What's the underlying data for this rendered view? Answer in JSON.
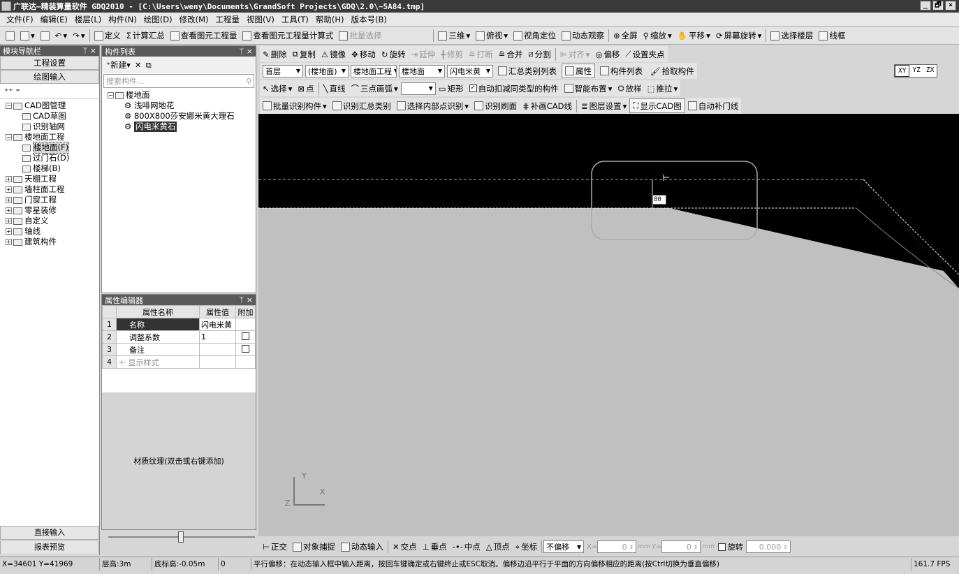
{
  "title": "广联达—精装算量软件 GDQ2010 - [C:\\Users\\weny\\Documents\\GrandSoft Projects\\GDQ\\2.0\\~5A84.tmp]",
  "window_controls": [
    "_",
    "🗗",
    "×"
  ],
  "menu": [
    "文件(F)",
    "编辑(E)",
    "楼层(L)",
    "构件(N)",
    "绘图(D)",
    "修改(M)",
    "工程量",
    "视图(V)",
    "工具(T)",
    "帮助(H)",
    "版本号(B)"
  ],
  "main_toolbar": {
    "define": "定义",
    "sum": "计算汇总",
    "view_qty": "查看图元工程量",
    "view_formula": "查看图元工程量计算式",
    "batch_select": "批量选择",
    "threeD": "三维",
    "top_view": "俯视",
    "view_locate": "视角定位",
    "dynamic": "动态观察",
    "fullscreen": "全屏",
    "zoom": "缩放",
    "pan": "平移",
    "rotate_screen": "屏幕旋转",
    "select_floor": "选择楼层",
    "wireframe": "线框"
  },
  "nav": {
    "title": "模块导航栏",
    "btn_project": "工程设置",
    "btn_draw": "绘图输入",
    "tree": [
      {
        "label": "CAD图管理",
        "level": 0,
        "expanded": true
      },
      {
        "label": "CAD草图",
        "level": 1
      },
      {
        "label": "识别轴网",
        "level": 1
      },
      {
        "label": "楼地面工程",
        "level": 0,
        "expanded": true
      },
      {
        "label": "楼地面(F)",
        "level": 1,
        "selected": true
      },
      {
        "label": "过门石(D)",
        "level": 1
      },
      {
        "label": "楼梯(B)",
        "level": 1
      },
      {
        "label": "天棚工程",
        "level": 0
      },
      {
        "label": "墙柱面工程",
        "level": 0
      },
      {
        "label": "门窗工程",
        "level": 0
      },
      {
        "label": "零星装修",
        "level": 0
      },
      {
        "label": "自定义",
        "level": 0
      },
      {
        "label": "轴线",
        "level": 0
      },
      {
        "label": "建筑构件",
        "level": 0
      }
    ],
    "btn_direct": "直接输入",
    "btn_report": "报表预览"
  },
  "comp": {
    "title": "构件列表",
    "new": "新建",
    "search_placeholder": "搜索构件...",
    "root": "楼地面",
    "items": [
      "浅啡网地花",
      "800X800莎安娜米黄大理石",
      "闪电米黄石"
    ]
  },
  "props": {
    "title": "属性编辑器",
    "headers": [
      "属性名称",
      "属性值",
      "附加"
    ],
    "rows": [
      {
        "n": "1",
        "name": "名称",
        "value": "闪电米黄"
      },
      {
        "n": "2",
        "name": "调整系数",
        "value": "1"
      },
      {
        "n": "3",
        "name": "备注",
        "value": ""
      },
      {
        "n": "4",
        "name": "显示样式",
        "value": ""
      }
    ],
    "texture": "材质纹理(双击或右键添加)"
  },
  "edit_tb": {
    "delete": "删除",
    "copy": "复制",
    "mirror": "镜像",
    "move": "移动",
    "rotate": "旋转",
    "extend": "延伸",
    "trim": "修剪",
    "break": "打断",
    "merge": "合并",
    "split": "分割",
    "align": "对齐",
    "offset": "偏移",
    "set_grip": "设置夹点"
  },
  "filter_tb": {
    "floor": "首层",
    "cat": "(楼地面)",
    "type": "楼地面工程",
    "sub": "楼地面",
    "comp": "闪电米黄",
    "sum_list": "汇总类别列表",
    "attr": "属性",
    "comp_list": "构件列表",
    "pick": "拾取构件"
  },
  "draw_tb": {
    "select": "选择",
    "point": "点",
    "line": "直线",
    "arc": "三点画弧",
    "rect": "矩形",
    "auto_deduct": "自动扣减同类型的构件",
    "smart": "智能布置",
    "loft": "放样",
    "push": "推拉"
  },
  "cad_tb": {
    "batch": "批量识别构件",
    "sum_id": "识别汇总类别",
    "inner": "选择内部点识别",
    "face": "识别刷面",
    "cad_line": "补画CAD线",
    "layer": "图层设置",
    "show_cad": "显示CAD图",
    "auto_door": "自动补门线"
  },
  "view_xyz": [
    "XY",
    "YZ",
    "ZX"
  ],
  "canvas": {
    "dim_value": "80",
    "axis_y": "Y",
    "axis_x": "X",
    "axis_z": "Z"
  },
  "snap_tb": {
    "ortho": "正交",
    "osnap": "对象捕捉",
    "dyn": "动态输入",
    "inter": "交点",
    "perp": "垂点",
    "mid": "中点",
    "vertex": "顶点",
    "coord": "坐标",
    "offset_mode": "不偏移",
    "x_label": "X=",
    "x_val": "0",
    "unit": "mm",
    "y_label": "Y=",
    "y_val": "0",
    "rotate": "旋转",
    "angle": "0.000"
  },
  "status": {
    "coords": "X=34601 Y=41969",
    "floor_h": "层高:3m",
    "base_h": "底标高:-0.05m",
    "zero": "0",
    "hint": "平行偏移：在动态输入框中输入距离，按回车键确定或右键终止或ESC取消。偏移边沿平行于平面的方向偏移相应的距离(按Ctrl切换为垂直偏移)",
    "fps": "161.7 FPS"
  }
}
